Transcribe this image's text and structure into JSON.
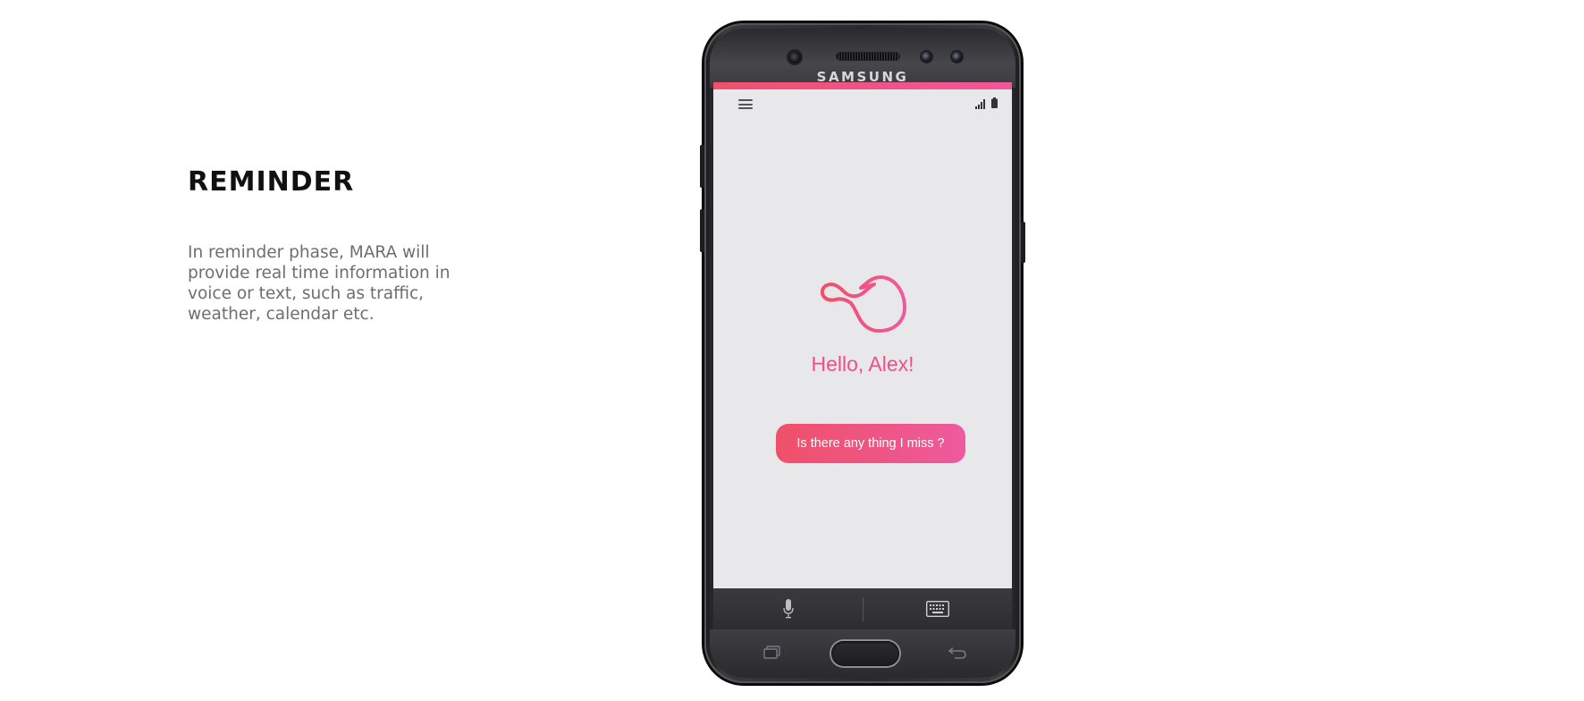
{
  "slide": {
    "heading": "REMINDER",
    "description": "In reminder phase, MARA will provide real time information in voice or text, such as traffic, weather, calendar etc."
  },
  "phone": {
    "brand": "SAMSUNG",
    "accent_colors": [
      "#f0506e",
      "#f0579a"
    ],
    "screen": {
      "greeting": "Hello, Alex!",
      "prompt_button": "Is there any thing I miss ?"
    },
    "input_bar": {
      "left_icon": "microphone-icon",
      "right_icon": "keyboard-icon"
    },
    "nav": {
      "left_icon": "recents-icon",
      "center": "home-button",
      "right_icon": "back-icon"
    }
  }
}
